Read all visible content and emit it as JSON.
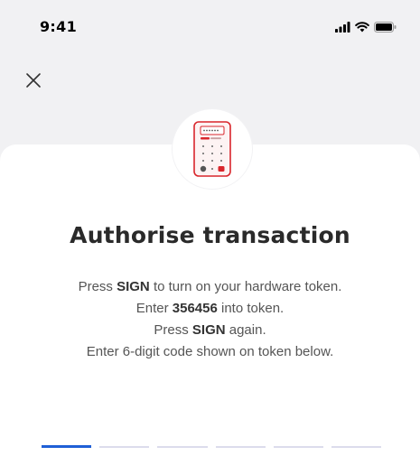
{
  "status_bar": {
    "time": "9:41",
    "icons": [
      "signal-icon",
      "wifi-icon",
      "battery-icon"
    ]
  },
  "header": {
    "close_icon": "close-icon"
  },
  "card": {
    "token_icon": "hardware-token-icon",
    "title": "Authorise transaction",
    "instructions": {
      "line1_pre": "Press ",
      "line1_bold": "SIGN",
      "line1_post": " to turn on your hardware token.",
      "line2_pre": "Enter ",
      "line2_bold": "356456",
      "line2_post": " into token.",
      "line3_pre": "Press ",
      "line3_bold": "SIGN",
      "line3_post": " again.",
      "line4": "Enter 6-digit code shown on token below."
    },
    "code_input": {
      "digits": 6,
      "active_index": 0
    }
  },
  "colors": {
    "accent": "#1f5fd6",
    "token_red": "#d9262c",
    "background": "#f1f1f3",
    "card": "#ffffff"
  }
}
